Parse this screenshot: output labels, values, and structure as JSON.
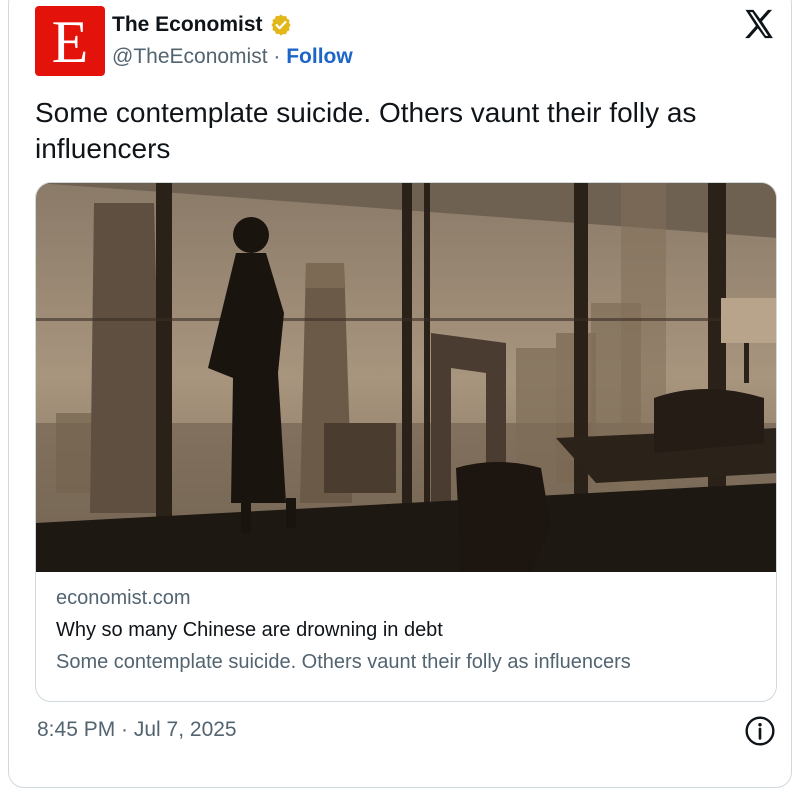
{
  "account": {
    "display_name": "The Economist",
    "handle": "@TheEconomist",
    "separator": " · ",
    "follow_label": "Follow",
    "avatar_letter": "E",
    "verified_color": "#e2b719"
  },
  "icons": {
    "platform": "x-logo-icon",
    "verified": "verified-badge-icon",
    "info": "info-icon"
  },
  "tweet": {
    "text": "Some contemplate suicide. Others vaunt their folly as influencers",
    "timestamp": "8:45 PM · Jul 7, 2025"
  },
  "link_card": {
    "domain": "economist.com",
    "title": "Why so many Chinese are drowning in debt",
    "description": "Some contemplate suicide. Others vaunt their folly as influencers"
  },
  "colors": {
    "brand": "#e3120b",
    "follow": "#1d65c9",
    "muted_text": "#536471",
    "border": "#cfd9de"
  }
}
